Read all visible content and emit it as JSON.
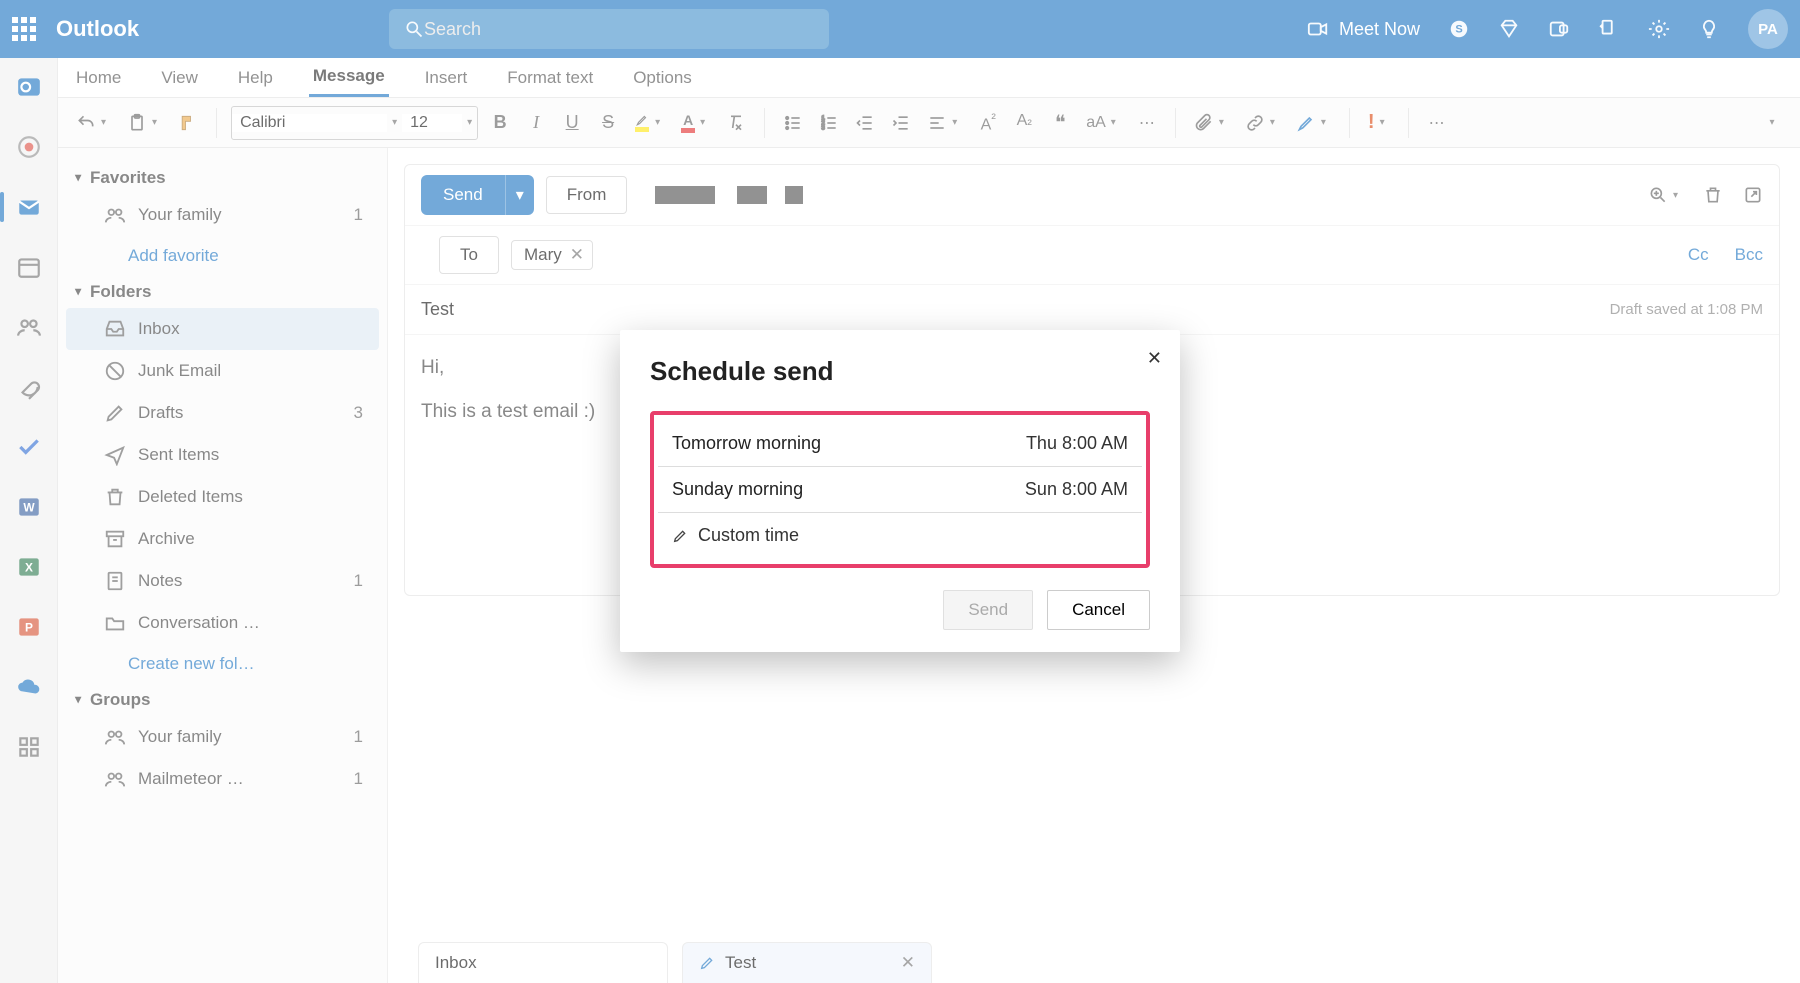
{
  "topbar": {
    "brand": "Outlook",
    "search_placeholder": "Search",
    "meet_now": "Meet Now",
    "avatar": "PA"
  },
  "ribbon_tabs": [
    "Home",
    "View",
    "Help",
    "Message",
    "Insert",
    "Format text",
    "Options"
  ],
  "ribbon_tabs_active": 3,
  "font": {
    "name": "Calibri",
    "size": "12"
  },
  "sidebar": {
    "favorites_label": "Favorites",
    "folders_label": "Folders",
    "groups_label": "Groups",
    "add_favorite": "Add favorite",
    "create_folder": "Create new fol…",
    "items": {
      "your_family": {
        "label": "Your family",
        "count": "1"
      },
      "inbox": {
        "label": "Inbox"
      },
      "junk": {
        "label": "Junk Email"
      },
      "drafts": {
        "label": "Drafts",
        "count": "3"
      },
      "sent": {
        "label": "Sent Items"
      },
      "deleted": {
        "label": "Deleted Items"
      },
      "archive": {
        "label": "Archive"
      },
      "notes": {
        "label": "Notes",
        "count": "1"
      },
      "conversation": {
        "label": "Conversation …"
      },
      "group_family": {
        "label": "Your family",
        "count": "1"
      },
      "mailmeteor": {
        "label": "Mailmeteor …",
        "count": "1"
      }
    }
  },
  "compose": {
    "send": "Send",
    "from": "From",
    "to": "To",
    "chip_name": "Mary",
    "cc": "Cc",
    "bcc": "Bcc",
    "subject": "Test",
    "draft_status": "Draft saved at 1:08 PM",
    "body_line1": "Hi,",
    "body_line2": "This is a test email :)"
  },
  "bottom_tabs": {
    "inbox": "Inbox",
    "draft": "Test"
  },
  "modal": {
    "title": "Schedule send",
    "rows": [
      {
        "label": "Tomorrow morning",
        "time": "Thu 8:00 AM"
      },
      {
        "label": "Sunday morning",
        "time": "Sun 8:00 AM"
      }
    ],
    "custom_label": "Custom time",
    "send": "Send",
    "cancel": "Cancel"
  }
}
